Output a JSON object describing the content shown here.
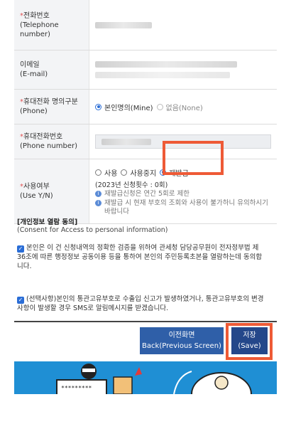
{
  "form": {
    "telephone": {
      "label_ko": "전화번호",
      "label_en": "(Telephone number)"
    },
    "email": {
      "label_ko": "이메일",
      "label_en": "(E-mail)"
    },
    "phone_owner": {
      "label_ko": "휴대전화 명의구분",
      "label_en": "(Phone)",
      "options": [
        {
          "label": "본인명의(Mine)",
          "selected": true
        },
        {
          "label": "없음(None)",
          "selected": false
        }
      ]
    },
    "phone_number": {
      "label_ko": "휴대전화번호",
      "label_en": "(Phone number)"
    },
    "use_yn": {
      "label_ko": "사용여부",
      "label_en": "(Use Y/N)",
      "options": [
        {
          "label": "사용",
          "selected": false
        },
        {
          "label": "사용중지",
          "selected": false
        },
        {
          "label": "재발급",
          "selected": true
        }
      ],
      "count_note": "(2023년 신청횟수 : 0회)",
      "notes": [
        "재발급신청은 연간 5회로 제한",
        "재발급 시 현재 부호의 조회와 사용이 불가하니 유의하시기 바랍니다"
      ]
    }
  },
  "consent": {
    "title": "[개인정보 열람 동의]",
    "subtitle": "(Consent for Access to personal information)",
    "agree_text": "본인은 이 건 신청내역의 정확한 검증을 위하여 관세청 담당공무원이 전자정부법 제 36조에 따른 행정정보 공동이용 등을 통하여 본인의 주민등록초본을 열람하는데 동의합니다.",
    "sms_text": "(선택사항)본인의 통관고유부호로 수출입 신고가 발생하였거나, 통관고유부호의 변경사항이 발생할 경우 SMS로 알림메시지를 받겠습니다."
  },
  "buttons": {
    "prev_ko": "이전화면",
    "prev_en": "Back(Previous Screen)",
    "save_ko": "저장",
    "save_en": "(Save)"
  },
  "colors": {
    "required_mark": "#e05353",
    "button_prev": "#2f5fa8",
    "button_save": "#24478a",
    "highlight": "#ee5a36",
    "banner": "#1f8fd4"
  }
}
